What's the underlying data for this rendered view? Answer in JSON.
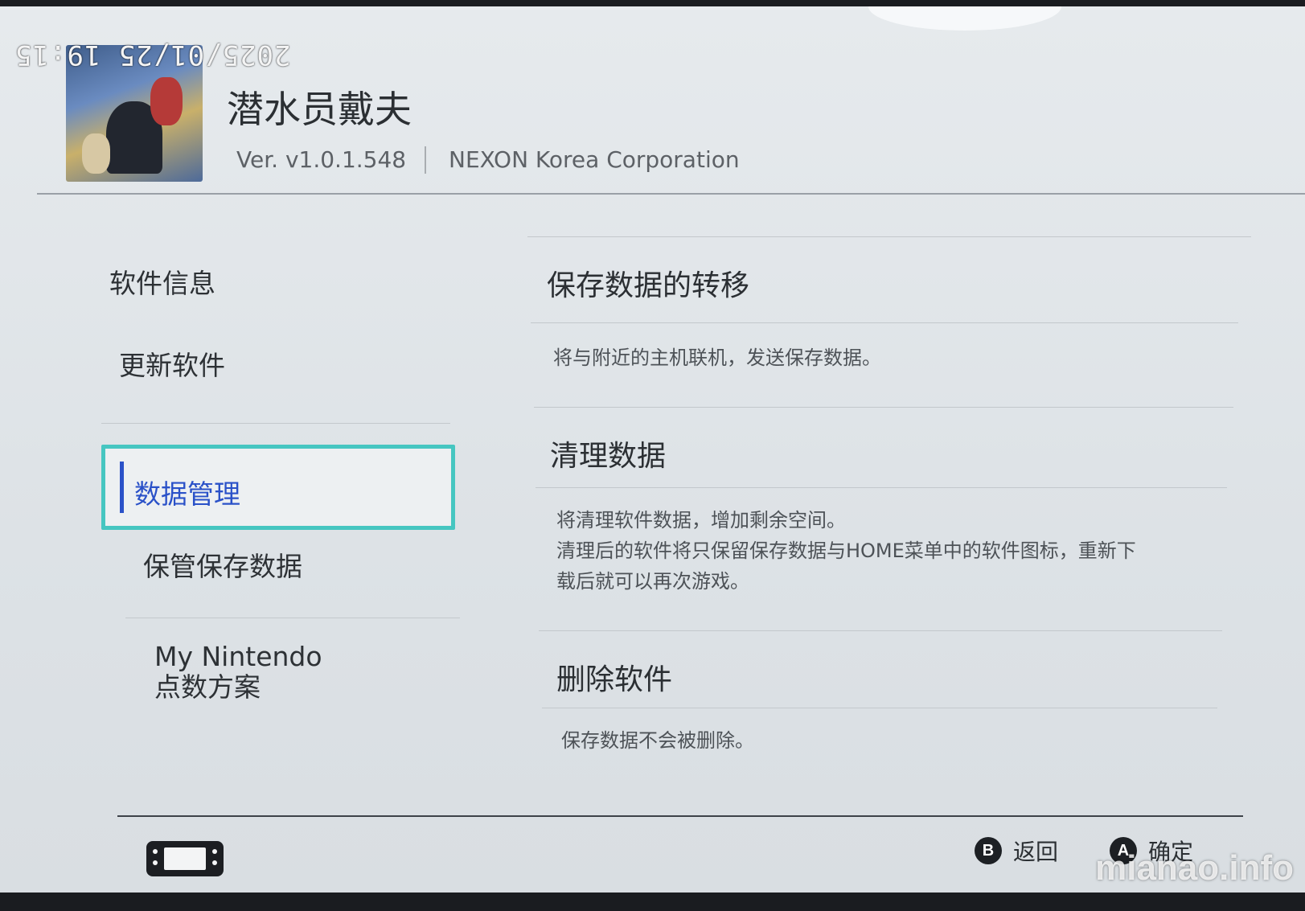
{
  "overlay": {
    "timestamp": "2025/01/25 19:15",
    "watermark": "mianao.info"
  },
  "header": {
    "game_title": "潜水员戴夫",
    "version": "Ver. v1.0.1.548",
    "publisher": "NEXON Korea Corporation"
  },
  "sidebar": {
    "items": [
      {
        "label": "软件信息"
      },
      {
        "label": "更新软件"
      },
      {
        "label": "数据管理",
        "active": true
      },
      {
        "label": "保管保存数据"
      },
      {
        "label_line1": "My Nintendo",
        "label_line2": "点数方案"
      }
    ]
  },
  "main": {
    "sections": [
      {
        "title": "保存数据的转移",
        "desc": [
          "将与附近的主机联机，发送保存数据。"
        ]
      },
      {
        "title": "清理数据",
        "desc": [
          "将清理软件数据，增加剩余空间。",
          "清理后的软件将只保留保存数据与HOME菜单中的软件图标，重新下",
          "载后就可以再次游戏。"
        ]
      },
      {
        "title": "删除软件",
        "desc": [
          "保存数据不会被删除。"
        ]
      }
    ]
  },
  "footer": {
    "back": {
      "key": "B",
      "label": "返回"
    },
    "confirm": {
      "key": "A",
      "label": "确定"
    }
  },
  "colors": {
    "accent_blue": "#2a51c8",
    "focus_teal": "#46c6c1"
  },
  "icons": [
    "game-icon",
    "handheld-console-icon",
    "b-button-icon",
    "a-button-icon"
  ]
}
